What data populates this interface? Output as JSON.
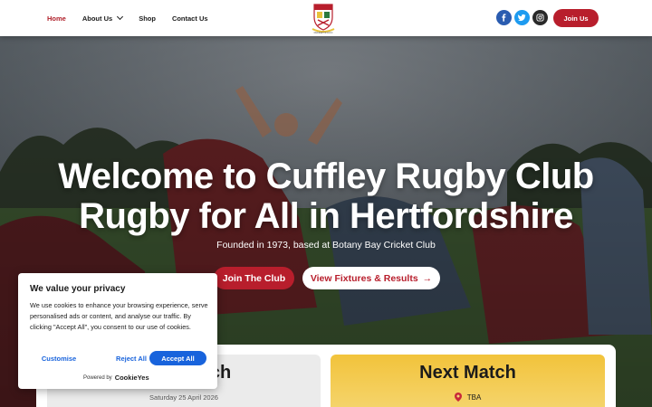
{
  "header": {
    "nav": [
      {
        "label": "Home",
        "active": true
      },
      {
        "label": "About Us",
        "dropdown": true
      },
      {
        "label": "Shop"
      },
      {
        "label": "Contact Us"
      }
    ],
    "logo_caption": "CUFFLEY R.U.F.C",
    "socials": [
      "facebook-icon",
      "twitter-icon",
      "instagram-icon"
    ],
    "join_label": "Join Us"
  },
  "hero": {
    "title_line1": "Welcome to Cuffley Rugby Club",
    "title_line2": "Rugby for All in Hertfordshire",
    "subtitle": "Founded in 1973, based at Botany Bay Cricket Club",
    "cta_primary": "Join The Club",
    "cta_secondary": "View Fixtures & Results",
    "cta_secondary_arrow": "→"
  },
  "matches": {
    "last": {
      "title": "Last Match",
      "date": "Saturday 25 April 2026"
    },
    "next": {
      "title": "Next Match",
      "venue": "TBA"
    }
  },
  "cookie": {
    "title": "We value your privacy",
    "text": "We use cookies to enhance your browsing experience, serve personalised ads or content, and analyse our traffic. By clicking \"Accept All\", you consent to our use of cookies.",
    "customise": "Customise",
    "reject": "Reject All",
    "accept": "Accept All",
    "powered_by": "Powered by",
    "brand": "CookieYes"
  },
  "colors": {
    "brand_red": "#b81e2c",
    "cookie_blue": "#1863dc",
    "next_match_yellow": "#f2c33b"
  }
}
